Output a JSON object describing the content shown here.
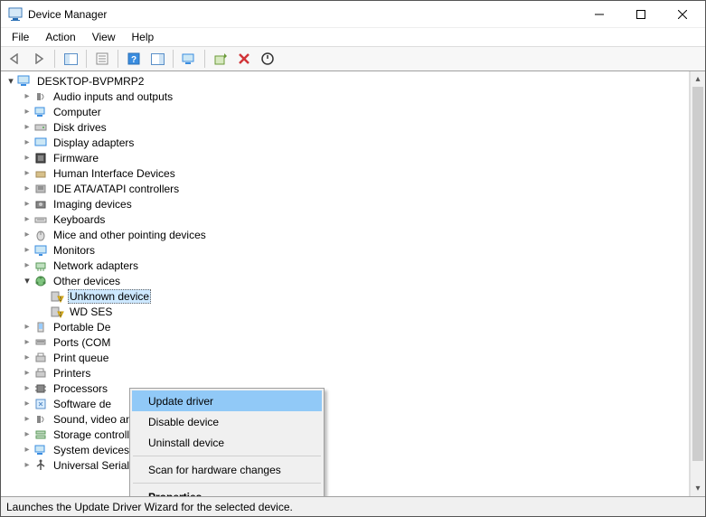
{
  "window": {
    "title": "Device Manager"
  },
  "menubar": {
    "file": "File",
    "action": "Action",
    "view": "View",
    "help": "Help"
  },
  "tree": {
    "root": "DESKTOP-BVPMRP2",
    "categories": [
      "Audio inputs and outputs",
      "Computer",
      "Disk drives",
      "Display adapters",
      "Firmware",
      "Human Interface Devices",
      "IDE ATA/ATAPI controllers",
      "Imaging devices",
      "Keyboards",
      "Mice and other pointing devices",
      "Monitors",
      "Network adapters",
      "Other devices",
      "Portable Devices",
      "Ports (COM & LPT)",
      "Print queues",
      "Printers",
      "Processors",
      "Software devices",
      "Sound, video and game controllers",
      "Storage controllers",
      "System devices",
      "Universal Serial Bus controllers"
    ],
    "other_devices_children": [
      "Unknown device",
      "WD SES Device"
    ]
  },
  "context_menu": {
    "update_driver": "Update driver",
    "disable_device": "Disable device",
    "uninstall_device": "Uninstall device",
    "scan_hardware": "Scan for hardware changes",
    "properties": "Properties"
  },
  "statusbar": {
    "text": "Launches the Update Driver Wizard for the selected device."
  }
}
